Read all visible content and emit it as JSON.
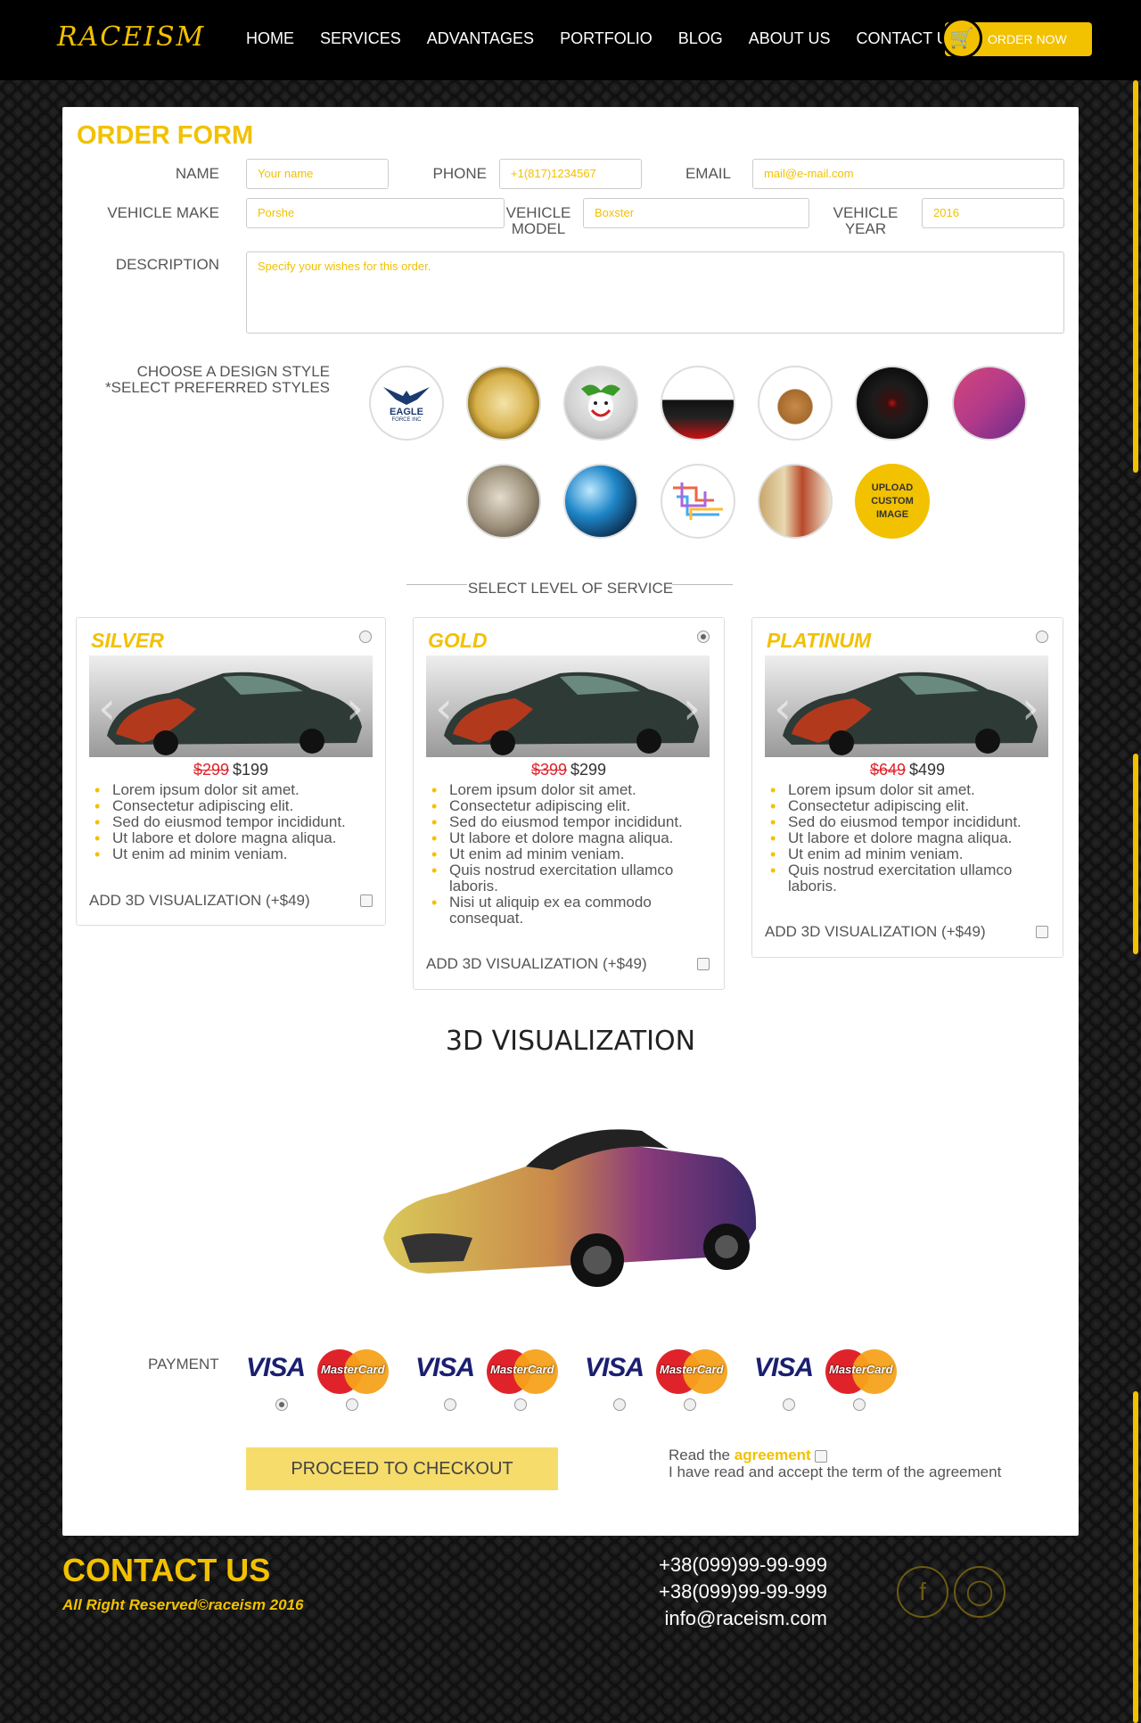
{
  "nav": {
    "logo": "RACEISM",
    "items": [
      "HOME",
      "SERVICES",
      "ADVANTAGES",
      "PORTFOLIO",
      "BLOG",
      "ABOUT US",
      "CONTACT US"
    ],
    "order_label": "ORDER NOW"
  },
  "form": {
    "title": "ORDER FORM",
    "name_label": "NAME",
    "name_placeholder": "Your name",
    "phone_label": "PHONE",
    "phone_placeholder": "+1(817)1234567",
    "email_label": "EMAIL",
    "email_placeholder": "mail@e-mail.com",
    "make_label": "VEHICLE MAKE",
    "make_value": "Porshe",
    "model_label1": "VEHICLE",
    "model_label2": "MODEL",
    "model_value": "Boxster",
    "year_label1": "VEHICLE",
    "year_label2": "YEAR",
    "year_value": "2016",
    "desc_label": "DESCRIPTION",
    "desc_placeholder": "Specify your wishes for this order."
  },
  "design": {
    "label1": "CHOOSE A DESIGN STYLE",
    "label2": "*SELECT PREFERRED STYLES",
    "eagle_text": "EAGLE",
    "eagle_sub": "FORCE INC",
    "upload1": "UPLOAD",
    "upload2": "CUSTOM IMAGE"
  },
  "service": {
    "title": "SELECT LEVEL OF SERVICE",
    "tiers": [
      {
        "name": "SILVER",
        "old": "$299",
        "price": "$199",
        "features": [
          "Lorem ipsum dolor sit amet.",
          "Consectetur adipiscing elit.",
          "Sed do eiusmod tempor incididunt.",
          "Ut labore et dolore magna aliqua.",
          "Ut enim ad minim veniam."
        ],
        "addon": "ADD 3D VISUALIZATION (+$49)"
      },
      {
        "name": "GOLD",
        "old": "$399",
        "price": "$299",
        "features": [
          "Lorem ipsum dolor sit amet.",
          "Consectetur adipiscing elit.",
          "Sed do eiusmod tempor incididunt.",
          "Ut labore et dolore magna aliqua.",
          "Ut enim ad minim veniam.",
          "Quis nostrud exercitation ullamco laboris.",
          "Nisi ut aliquip ex ea commodo consequat."
        ],
        "addon": "ADD 3D VISUALIZATION (+$49)"
      },
      {
        "name": "PLATINUM",
        "old": "$649",
        "price": "$499",
        "features": [
          "Lorem ipsum dolor sit amet.",
          "Consectetur adipiscing elit.",
          "Sed do eiusmod tempor incididunt.",
          "Ut labore et dolore magna aliqua.",
          "Ut enim ad minim veniam.",
          "Quis nostrud exercitation ullamco laboris."
        ],
        "addon": "ADD 3D VISUALIZATION (+$49)"
      }
    ],
    "selected": "GOLD"
  },
  "viz": {
    "title": "3D VISUALIZATION"
  },
  "payment": {
    "label": "PAYMENT",
    "visa": "VISA",
    "mastercard": "MasterCard"
  },
  "checkout": {
    "button": "PROCEED TO CHECKOUT",
    "agree1": "Read the ",
    "agree_link": "agreement",
    "agree2": "I have read and accept the term of the agreement"
  },
  "footer": {
    "title": "CONTACT US",
    "copyright": "All Right Reserved©raceism 2016",
    "phone1": "+38(099)99-99-999",
    "phone2": "+38(099)99-99-999",
    "email": "info@raceism.com"
  },
  "colors": {
    "accent": "#f2c100",
    "old_price": "#e0232b",
    "checkout_bg": "#f6dc6b"
  }
}
